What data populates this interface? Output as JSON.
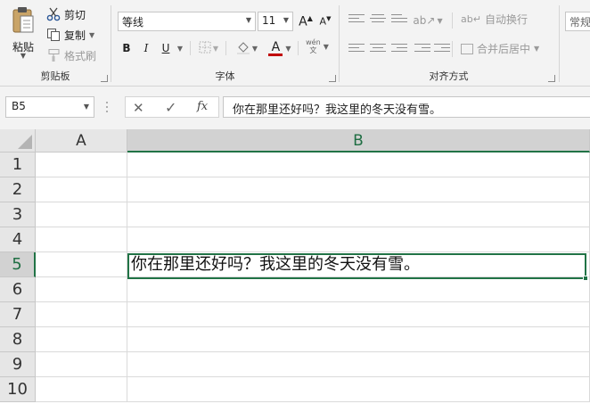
{
  "ribbon": {
    "clipboard": {
      "paste_label": "粘贴",
      "cut_label": "剪切",
      "copy_label": "复制",
      "format_painter_label": "格式刷",
      "group_label": "剪贴板"
    },
    "font": {
      "font_name": "等线",
      "font_size": "11",
      "bold": "B",
      "italic": "I",
      "underline": "U",
      "font_color_letter": "A",
      "phonetic_label": "wén\n文",
      "group_label": "字体"
    },
    "alignment": {
      "wrap_text_label": "自动换行",
      "merge_center_label": "合并后居中",
      "group_label": "对齐方式"
    },
    "number": {
      "format_label": "常规"
    }
  },
  "formula_bar": {
    "name_box": "B5",
    "fx_label": "fx",
    "content": "你在那里还好吗？我这里的冬天没有雪。"
  },
  "sheet": {
    "columns": [
      "A",
      "B"
    ],
    "rows": [
      "1",
      "2",
      "3",
      "4",
      "5",
      "6",
      "7",
      "8",
      "9",
      "10"
    ],
    "active_cell": "B5",
    "cell_b5": "你在那里还好吗？我这里的冬天没有雪。"
  },
  "colors": {
    "accent": "#217346",
    "font_color_bar": "#c00000"
  }
}
